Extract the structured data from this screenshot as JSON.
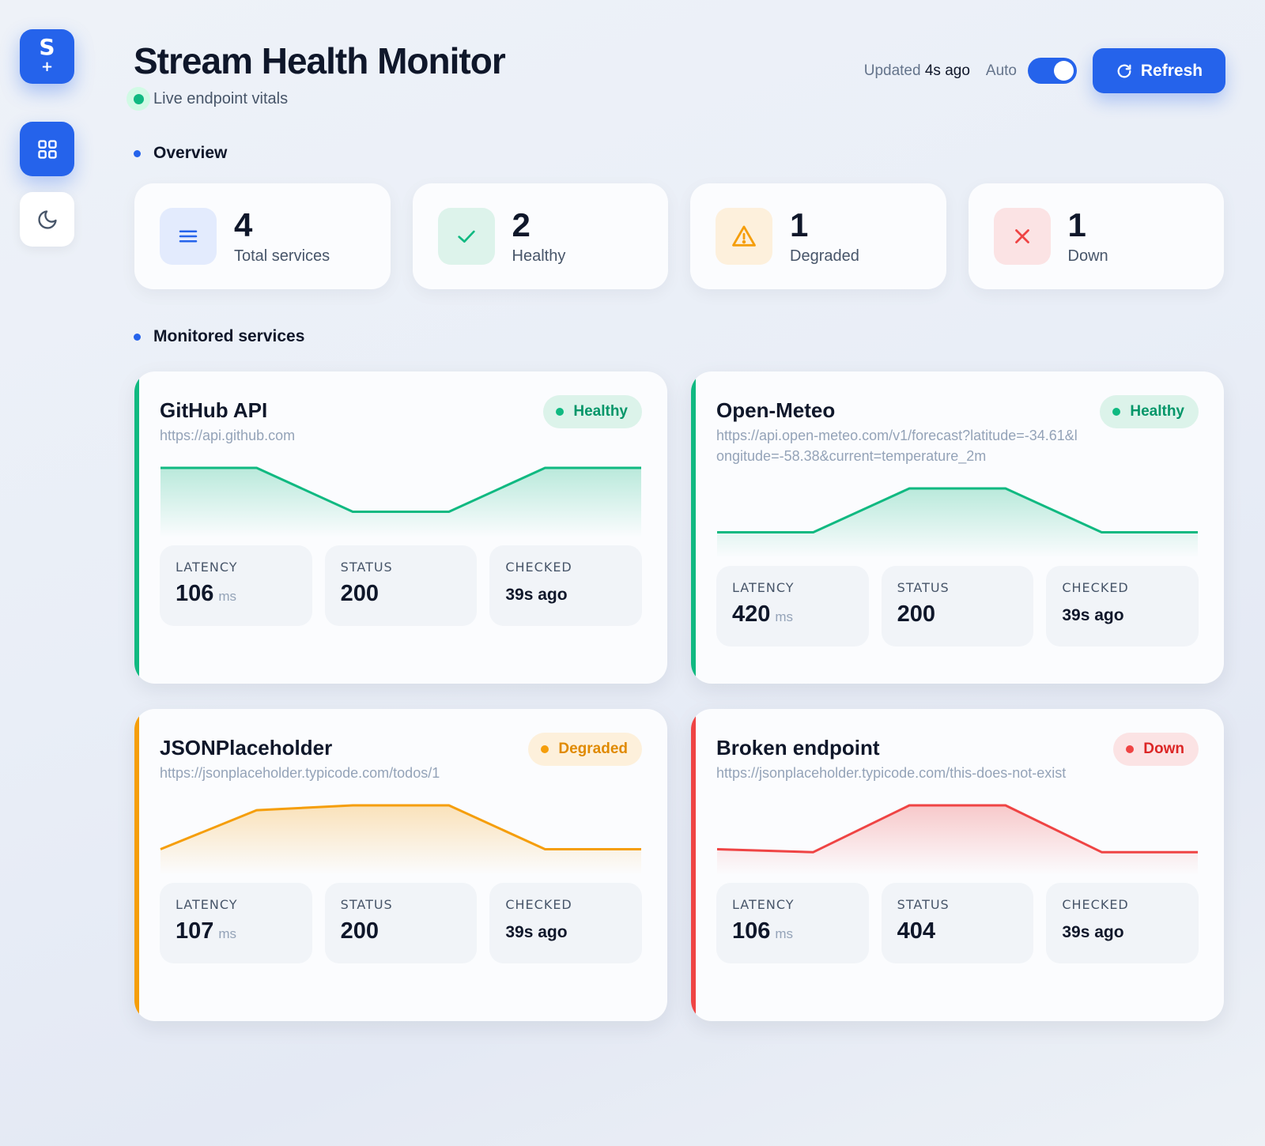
{
  "sidebar": {
    "logo_letter": "S",
    "logo_mark": "+"
  },
  "header": {
    "title": "Stream Health Monitor",
    "subtitle": "Live endpoint vitals",
    "updated_prefix": "Updated",
    "updated_value": "4s ago",
    "auto_label": "Auto",
    "auto_enabled": true,
    "refresh_label": "Refresh"
  },
  "overview": {
    "heading": "Overview",
    "stats": [
      {
        "value": "4",
        "label": "Total services",
        "icon": "list-icon",
        "color": "#2563eb",
        "bg": "#e3ebfd"
      },
      {
        "value": "2",
        "label": "Healthy",
        "icon": "check-icon",
        "color": "#10b981",
        "bg": "#ddf3eb"
      },
      {
        "value": "1",
        "label": "Degraded",
        "icon": "warning-icon",
        "color": "#f59e0b",
        "bg": "#fdf0dc"
      },
      {
        "value": "1",
        "label": "Down",
        "icon": "x-icon",
        "color": "#ef4444",
        "bg": "#fbe3e4"
      }
    ]
  },
  "services_section": {
    "heading": "Monitored services",
    "labels": {
      "latency": "LATENCY",
      "status": "STATUS",
      "checked": "CHECKED",
      "unit": "ms"
    },
    "items": [
      {
        "name": "GitHub API",
        "url": "https://api.github.com",
        "status_label": "Healthy",
        "color": "#10b981",
        "badge_bg": "#dcf3ea",
        "badge_text": "#059669",
        "latency": "106",
        "status_code": "200",
        "checked": "39s ago",
        "history": [
          0.6,
          0.6,
          0.15,
          0.15,
          0.6,
          0.6
        ]
      },
      {
        "name": "Open-Meteo",
        "url": "https://api.open-meteo.com/v1/forecast?latitude=-34.61&longitude=-58.38&current=temperature_2m",
        "status_label": "Healthy",
        "color": "#10b981",
        "badge_bg": "#dcf3ea",
        "badge_text": "#059669",
        "latency": "420",
        "status_code": "200",
        "checked": "39s ago",
        "history": [
          0.15,
          0.15,
          0.6,
          0.6,
          0.15,
          0.15
        ]
      },
      {
        "name": "JSONPlaceholder",
        "url": "https://jsonplaceholder.typicode.com/todos/1",
        "status_label": "Degraded",
        "color": "#f59e0b",
        "badge_bg": "#fdf0db",
        "badge_text": "#e08a00",
        "latency": "107",
        "status_code": "200",
        "checked": "39s ago",
        "history": [
          0.15,
          0.55,
          0.6,
          0.6,
          0.15,
          0.15
        ]
      },
      {
        "name": "Broken endpoint",
        "url": "https://jsonplaceholder.typicode.com/this-does-not-exist",
        "status_label": "Down",
        "color": "#ef4444",
        "badge_bg": "#fbe3e4",
        "badge_text": "#dc2626",
        "latency": "106",
        "status_code": "404",
        "checked": "39s ago",
        "history": [
          0.15,
          0.12,
          0.6,
          0.6,
          0.12,
          0.12
        ]
      }
    ]
  }
}
